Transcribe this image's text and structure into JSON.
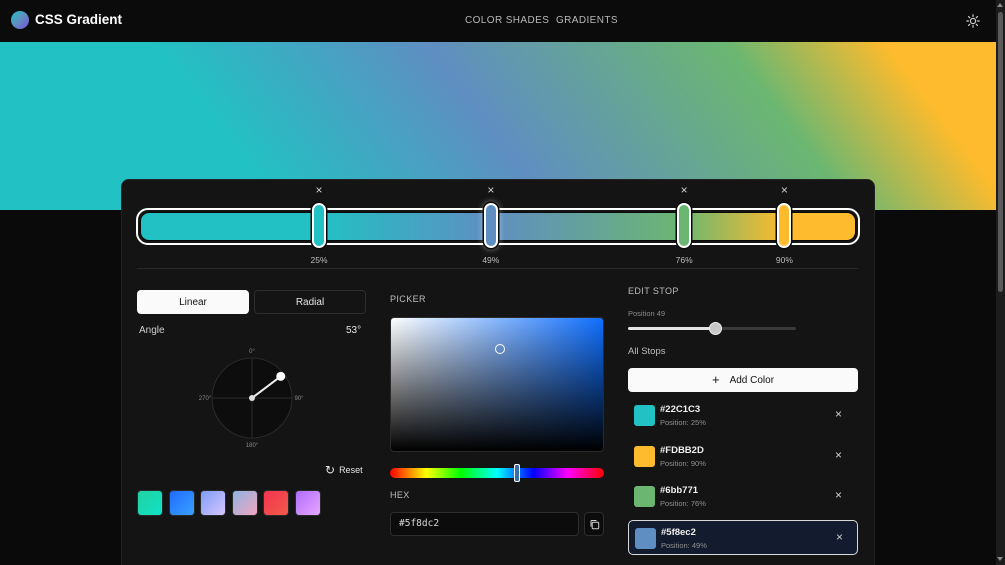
{
  "header": {
    "brand": "CSS Gradient",
    "nav": [
      {
        "label": "COLOR SHADES"
      },
      {
        "label": "GRADIENTS"
      }
    ],
    "theme_icon": "sun-icon"
  },
  "gradient": {
    "stops": [
      {
        "hex": "#22C1C3",
        "color": "#22c1c3",
        "position": 25,
        "position_label": "25%",
        "list_position": "Position: 25%"
      },
      {
        "hex": "#5f8ec2",
        "color": "#5f8ec2",
        "position": 49,
        "position_label": "49%",
        "list_position": "Position: 49%"
      },
      {
        "hex": "#6bb771",
        "color": "#6bb771",
        "position": 76,
        "position_label": "76%",
        "list_position": "Position: 76%"
      },
      {
        "hex": "#FDBB2D",
        "color": "#fdbb2d",
        "position": 90,
        "position_label": "90%",
        "list_position": "Position: 90%"
      }
    ],
    "angle_deg": 53,
    "remove_symbol": "×"
  },
  "controls": {
    "linear_label": "Linear",
    "radial_label": "Radial",
    "active_type": "Linear",
    "angle_label": "Angle",
    "angle_value": "53°",
    "dial_labels": {
      "top": "0°",
      "right": "90°",
      "bottom": "180°",
      "left": "270°"
    },
    "reset_label": "Reset",
    "presets": [
      {
        "from": "#22d1a0",
        "to": "#0fe3c6"
      },
      {
        "from": "#1e6cff",
        "to": "#3aa0ff"
      },
      {
        "from": "#7f9cf5",
        "to": "#d6c6ff"
      },
      {
        "from": "#8fb3e0",
        "to": "#f0a6c0"
      },
      {
        "from": "#f3344f",
        "to": "#f25a4a"
      },
      {
        "from": "#b06cff",
        "to": "#e7a6ff"
      }
    ]
  },
  "picker": {
    "label": "PICKER",
    "hex_label": "HEX",
    "hex_value": "#5f8dc2",
    "copy_icon": "copy-icon"
  },
  "edit_stop": {
    "label": "EDIT STOP",
    "position_label": "Position 49",
    "position_value": 49,
    "all_stops_label": "All Stops",
    "add_color_label": "Add Color",
    "list": [
      {
        "hex": "#22C1C3",
        "position": "Position: 25%",
        "color": "#22c1c3",
        "active": false
      },
      {
        "hex": "#FDBB2D",
        "position": "Position: 90%",
        "color": "#fdbb2d",
        "active": false
      },
      {
        "hex": "#6bb771",
        "position": "Position: 76%",
        "color": "#6bb771",
        "active": false
      },
      {
        "hex": "#5f8ec2",
        "position": "Position: 49%",
        "color": "#5f8ec2",
        "active": true
      }
    ]
  }
}
